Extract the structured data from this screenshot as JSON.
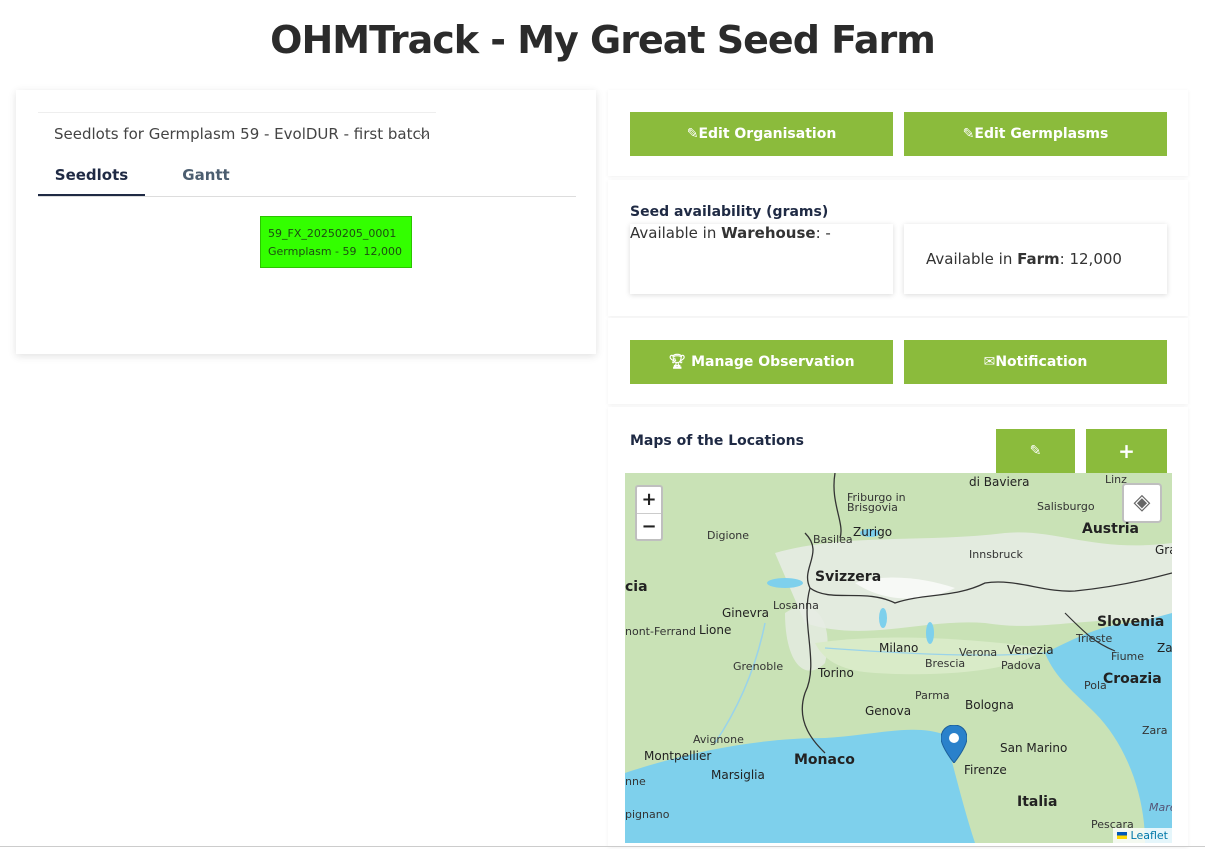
{
  "page_title": "OHMTrack - My Great Seed Farm",
  "seedlots_panel": {
    "select_value": "Seedlots for Germplasm 59 - EvolDUR - first batch",
    "tabs": [
      {
        "label": "Seedlots"
      },
      {
        "label": "Gantt"
      }
    ],
    "seedlot": {
      "code": "59_FX_20250205_0001",
      "detail": "Germplasm - 59  12,000"
    }
  },
  "buttons": {
    "edit_organisation": "Edit Organisation",
    "edit_germplasms": "Edit Germplasms",
    "manage_observation": "Manage Observation",
    "notification": "Notification"
  },
  "availability": {
    "heading": "Seed availability (grams)",
    "warehouse_prefix": "Available in ",
    "warehouse_label": "Warehouse",
    "warehouse_value": ": -",
    "farm_prefix": "Available in ",
    "farm_label": "Farm",
    "farm_value": ": 12,000"
  },
  "maps": {
    "heading": "Maps of the Locations",
    "zoom_in": "+",
    "zoom_out": "−",
    "attribution": "Leaflet",
    "places": {
      "monaco_baviera": "di Baviera",
      "friburgo": "Friburgo in Brisgovia",
      "salisburgo": "Salisburgo",
      "digione": "Digione",
      "basilea": "Basilea",
      "zurigo": "Zurigo",
      "austria": "Austria",
      "graz": "Graz",
      "innsbruck": "Innsbruck",
      "cia": "cia",
      "losanna": "Losanna",
      "svizzera": "Svizzera",
      "ginevra": "Ginevra",
      "slovenia": "Slovenia",
      "trieste": "Trieste",
      "clermont": "nont-Ferrand",
      "lione": "Lione",
      "fiume": "Fiume",
      "za": "Za",
      "milano": "Milano",
      "verona": "Verona",
      "venezia": "Venezia",
      "brescia": "Brescia",
      "padova": "Padova",
      "grenoble": "Grenoble",
      "torino": "Torino",
      "pola": "Pola",
      "croazia": "Croazia",
      "parma": "Parma",
      "bologna": "Bologna",
      "genova": "Genova",
      "zara": "Zara",
      "avignone": "Avignone",
      "montpellier": "Montpellier",
      "monaco": "Monaco",
      "san_marino": "San Marino",
      "marsiglia": "Marsiglia",
      "firenze": "Firenze",
      "nne": "nne",
      "italia": "Italia",
      "pignano": "pignano",
      "pescara": "Pescara",
      "mare": "Mare",
      "linz": "Linz"
    }
  },
  "colors": {
    "accent_green": "#8bbb3c",
    "seedlot_green": "#33ff00",
    "heading_navy": "#1f2a44"
  }
}
